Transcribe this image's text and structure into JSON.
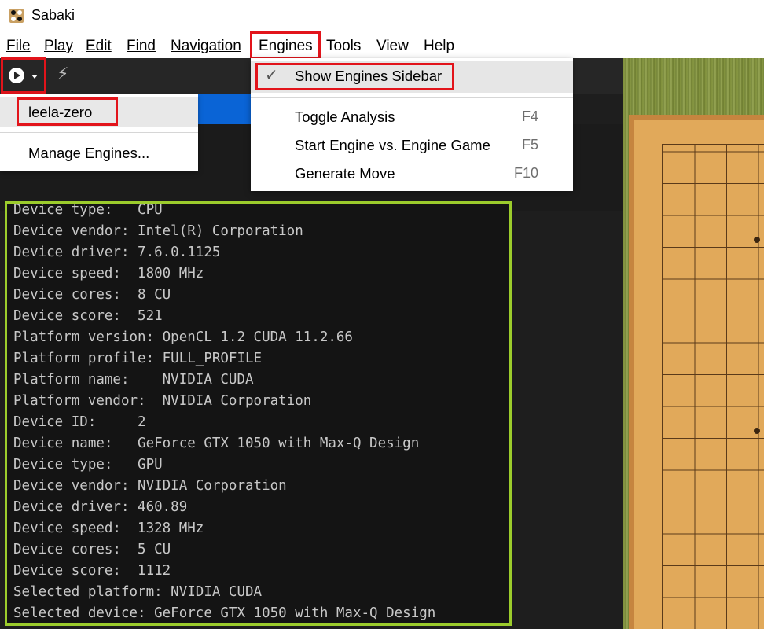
{
  "window": {
    "title": "Sabaki"
  },
  "menubar": {
    "items": [
      {
        "label": "File"
      },
      {
        "label": "Play"
      },
      {
        "label": "Edit"
      },
      {
        "label": "Find"
      },
      {
        "label": "Navigation"
      },
      {
        "label": "Engines"
      },
      {
        "label": "Tools"
      },
      {
        "label": "View"
      },
      {
        "label": "Help"
      }
    ]
  },
  "toolbar": {
    "play_icon": "play-circle-icon",
    "dropdown_icon": "caret-down-icon",
    "bolt_icon": "lightning-bolt-icon"
  },
  "engine_dropdown": {
    "items": [
      {
        "label": "leela-zero"
      },
      {
        "label": "Manage Engines..."
      }
    ]
  },
  "engines_menu": {
    "items": [
      {
        "label": "Show Engines Sidebar",
        "checked": true,
        "shortcut": ""
      },
      {
        "label": "Toggle Analysis",
        "shortcut": "F4"
      },
      {
        "label": "Start Engine vs. Engine Game",
        "shortcut": "F5"
      },
      {
        "label": "Generate Move",
        "shortcut": "F10"
      }
    ]
  },
  "console": {
    "lines": [
      "Device type:   CPU",
      "Device vendor: Intel(R) Corporation",
      "Device driver: 7.6.0.1125",
      "Device speed:  1800 MHz",
      "Device cores:  8 CU",
      "Device score:  521",
      "Platform version: OpenCL 1.2 CUDA 11.2.66",
      "Platform profile: FULL_PROFILE",
      "Platform name:    NVIDIA CUDA",
      "Platform vendor:  NVIDIA Corporation",
      "Device ID:     2",
      "Device name:   GeForce GTX 1050 with Max-Q Design",
      "Device type:   GPU",
      "Device vendor: NVIDIA Corporation",
      "Device driver: 460.89",
      "Device speed:  1328 MHz",
      "Device cores:  5 CU",
      "Device score:  1112",
      "Selected platform: NVIDIA CUDA",
      "Selected device: GeForce GTX 1050 with Max-Q Design"
    ]
  },
  "colors": {
    "highlight_red": "#e2141b",
    "console_border": "#9ccc2c",
    "toolbar_bg": "#262626",
    "board": "#e1a95a"
  }
}
